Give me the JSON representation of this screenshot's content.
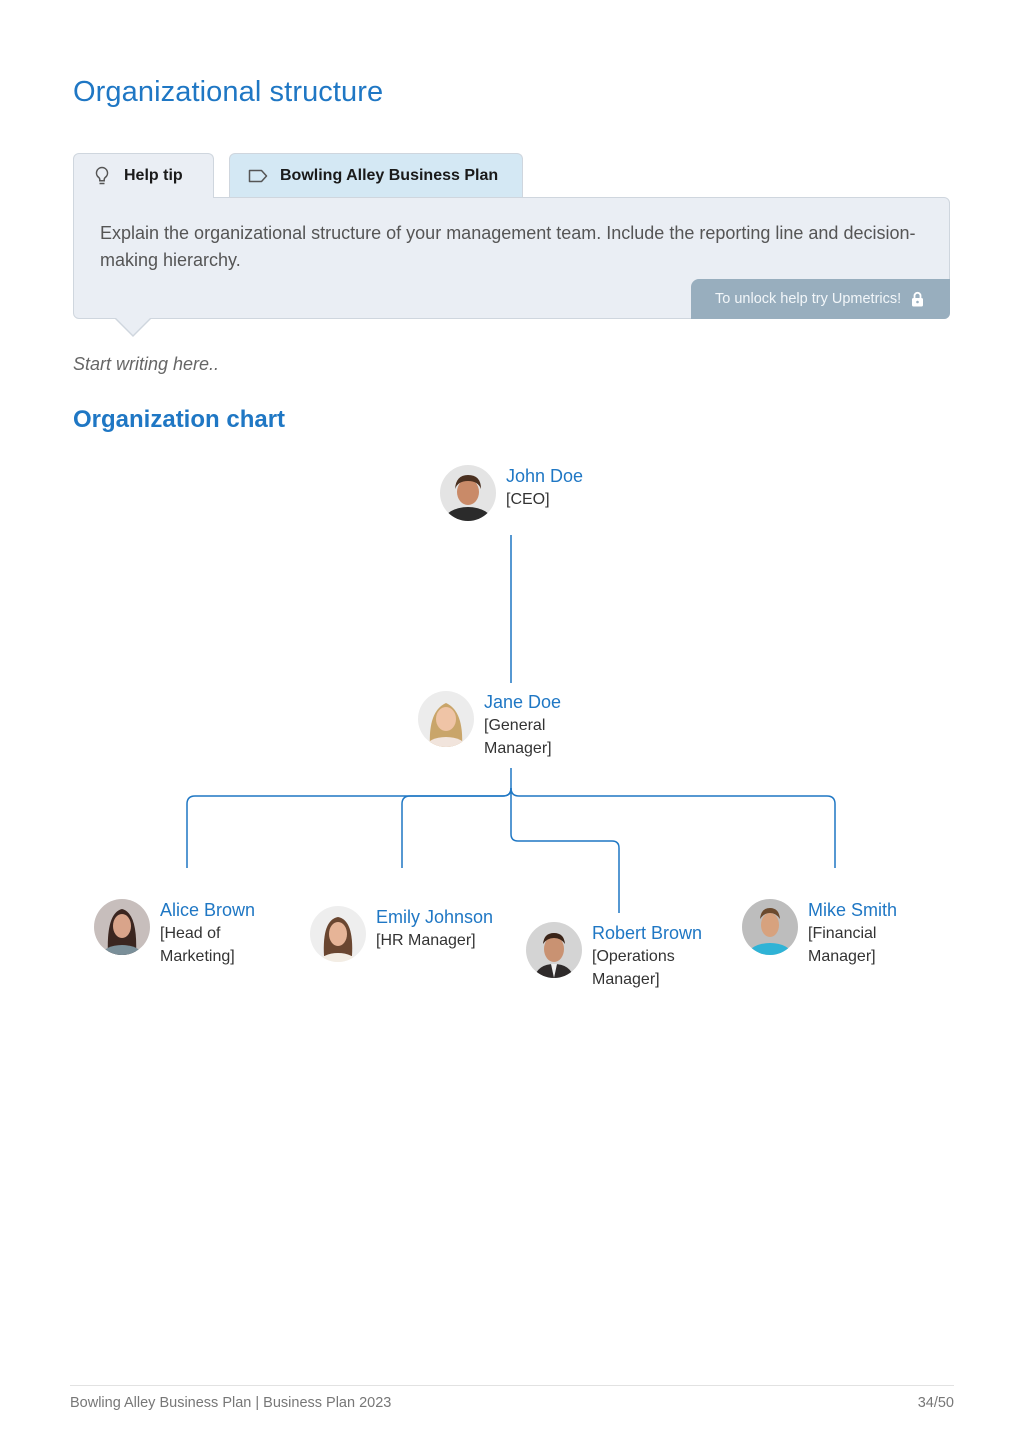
{
  "page": {
    "title": "Organizational structure",
    "tabs": [
      {
        "label": "Help tip",
        "icon": "lightbulb-icon"
      },
      {
        "label": "Bowling Alley Business Plan",
        "icon": "tag-icon"
      }
    ],
    "help_text": "Explain the organizational structure of your management team. Include the reporting line and decision-making hierarchy.",
    "unlock_label": "To unlock help try Upmetrics!",
    "unlock_icon": "lock-icon",
    "placeholder": "Start writing here..",
    "section_title": "Organization chart"
  },
  "org_chart": {
    "accent": "#1f77c4",
    "nodes": [
      {
        "name": "John Doe",
        "role": "[CEO]",
        "reports_to": null
      },
      {
        "name": "Jane Doe",
        "role": "[General Manager]",
        "reports_to": "John Doe"
      },
      {
        "name": "Alice Brown",
        "role": "[Head of Marketing]",
        "reports_to": "Jane Doe"
      },
      {
        "name": "Emily Johnson",
        "role": "[HR Manager]",
        "reports_to": "Jane Doe"
      },
      {
        "name": "Robert Brown",
        "role": "[Operations Manager]",
        "reports_to": "Jane Doe"
      },
      {
        "name": "Mike Smith",
        "role": "[Financial Manager]",
        "reports_to": "Jane Doe"
      }
    ]
  },
  "footer": {
    "left": "Bowling Alley Business Plan | Business Plan 2023",
    "page_number": "34/50"
  }
}
